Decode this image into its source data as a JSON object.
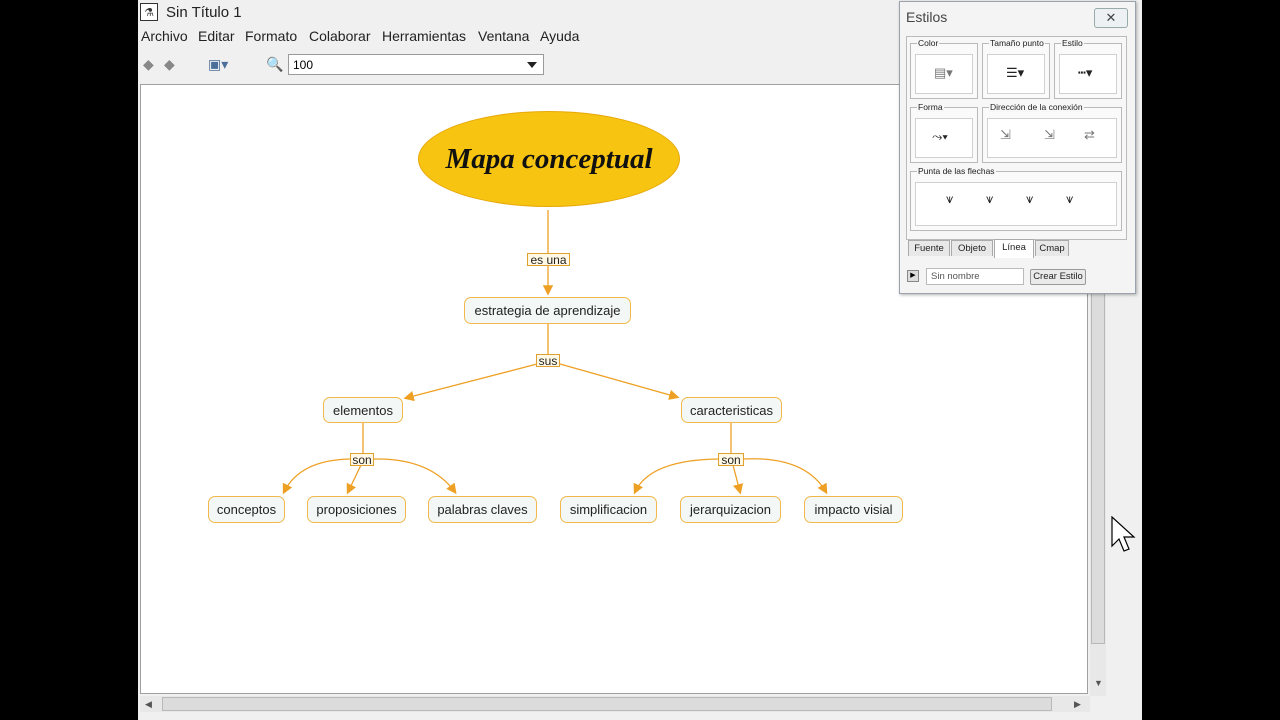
{
  "window": {
    "title": "Sin Título 1"
  },
  "menu": [
    "Archivo",
    "Editar",
    "Formato",
    "Colaborar",
    "Herramientas",
    "Ventana",
    "Ayuda"
  ],
  "toolbar": {
    "zoom_value": "100"
  },
  "concept_map": {
    "main_concept": "Mapa conceptual",
    "link_main": "es una",
    "level1": "estrategia de aprendizaje",
    "link_level1": "sus",
    "left_branch": "elementos",
    "right_branch": "caracteristicas",
    "link_left": "son",
    "link_right": "son",
    "left_children": [
      "conceptos",
      "proposiciones",
      "palabras claves"
    ],
    "right_children": [
      "simplificacion",
      "jerarquizacion",
      "impacto visial"
    ]
  },
  "styles_panel": {
    "title": "Estilos",
    "close": "✕",
    "groups": {
      "color": "Color",
      "tamano_punto": "Tamaño punto",
      "estilo": "Estilo",
      "forma": "Forma",
      "direccion": "Dirección de la conexión",
      "punta": "Punta de las flechas"
    },
    "tabs": [
      "Fuente",
      "Objeto",
      "Línea",
      "Cmap"
    ],
    "active_tab": "Línea",
    "name_field": "Sin nombre",
    "create_button": "Crear Estilo"
  },
  "colors": {
    "main_concept_fill": "#f7c411",
    "line_color": "#eea024",
    "node_fill": "#f3f8f6"
  }
}
